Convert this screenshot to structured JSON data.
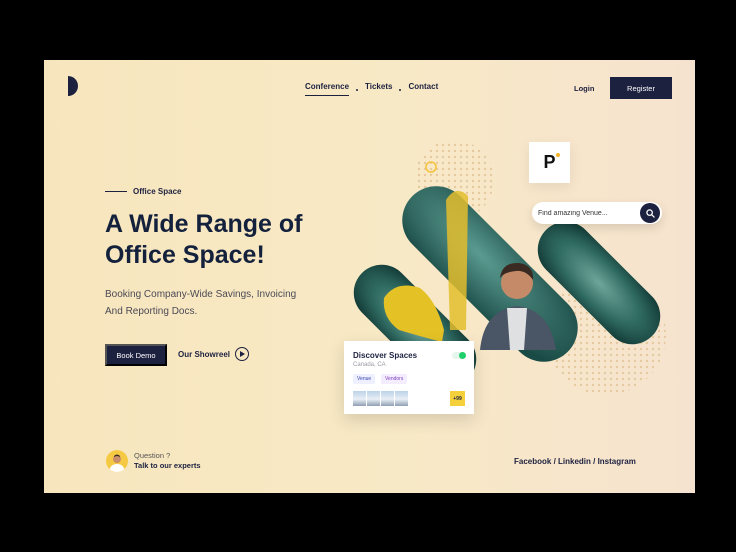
{
  "nav": {
    "items": [
      {
        "label": "Conference",
        "active": true
      },
      {
        "label": "Tickets",
        "active": false
      },
      {
        "label": "Contact",
        "active": false
      }
    ],
    "login": "Login",
    "register": "Register"
  },
  "hero": {
    "eyebrow": "Office Space",
    "title_line1": "A Wide Range of",
    "title_line2": "Office Space!",
    "subtitle_line1": "Booking Company-Wide Savings, Invoicing",
    "subtitle_line2": "And Reporting Docs.",
    "book_demo": "Book Demo",
    "showreel": "Our Showreel"
  },
  "expert": {
    "question": "Question ?",
    "cta": "Talk to our experts"
  },
  "social": {
    "text": "Facebook / Linkedin / Instagram"
  },
  "search": {
    "placeholder": "Find amazing Venue..."
  },
  "brand_card": {
    "letter": "P"
  },
  "discover": {
    "title": "Discover Spaces",
    "location": "Canada, CA",
    "tags": [
      "Venue",
      "Vendors"
    ],
    "badge": "+99"
  },
  "colors": {
    "navy": "#1d2140",
    "background": "#f7e6bd",
    "accent_yellow": "#f4d13a",
    "toggle_green": "#1fcf6b"
  },
  "icons": {
    "logo": "half-circle-logo-icon",
    "play": "play-icon",
    "search": "search-icon"
  }
}
